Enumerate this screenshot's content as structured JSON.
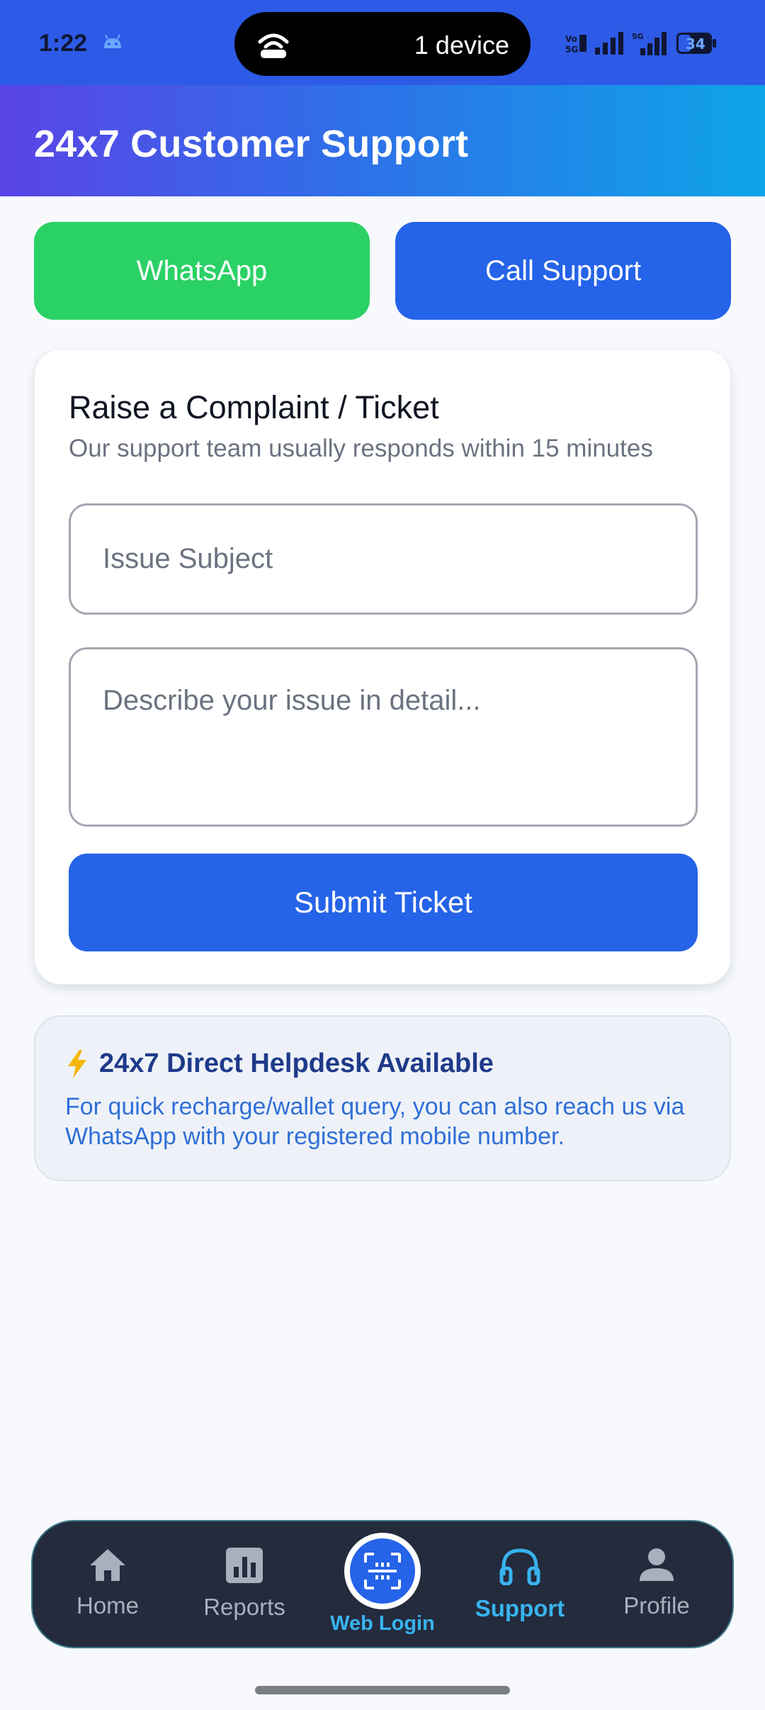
{
  "status_bar": {
    "time": "1:22",
    "hotspot_text": "1 device",
    "icons": [
      "android-icon",
      "hotspot-icon",
      "volte-icon",
      "signal-icon",
      "5g-signal-icon",
      "battery-icon"
    ],
    "battery_level": "34"
  },
  "header": {
    "title": "24x7 Customer Support"
  },
  "contact_buttons": {
    "whatsapp_label": "WhatsApp",
    "call_label": "Call Support",
    "whatsapp_color": "#2ad165",
    "call_color": "#2563e8"
  },
  "ticket_form": {
    "title": "Raise a Complaint / Ticket",
    "subtitle": "Our support team usually responds within 15 minutes",
    "subject_placeholder": "Issue Subject",
    "description_placeholder": "Describe your issue in detail...",
    "submit_label": "Submit Ticket"
  },
  "helpdesk": {
    "icon": "lightning-bolt-icon",
    "title": "24x7 Direct Helpdesk Available",
    "body": "For quick recharge/wallet query, you can also reach us via WhatsApp with your registered mobile number."
  },
  "bottom_nav": {
    "items": [
      {
        "label": "Home",
        "icon": "home-icon",
        "active": false
      },
      {
        "label": "Reports",
        "icon": "reports-icon",
        "active": false
      },
      {
        "label": "Web Login",
        "icon": "qr-scan-icon",
        "active": false
      },
      {
        "label": "Support",
        "icon": "headphones-icon",
        "active": true
      },
      {
        "label": "Profile",
        "icon": "profile-icon",
        "active": false
      }
    ],
    "active_color": "#38b3ee"
  }
}
